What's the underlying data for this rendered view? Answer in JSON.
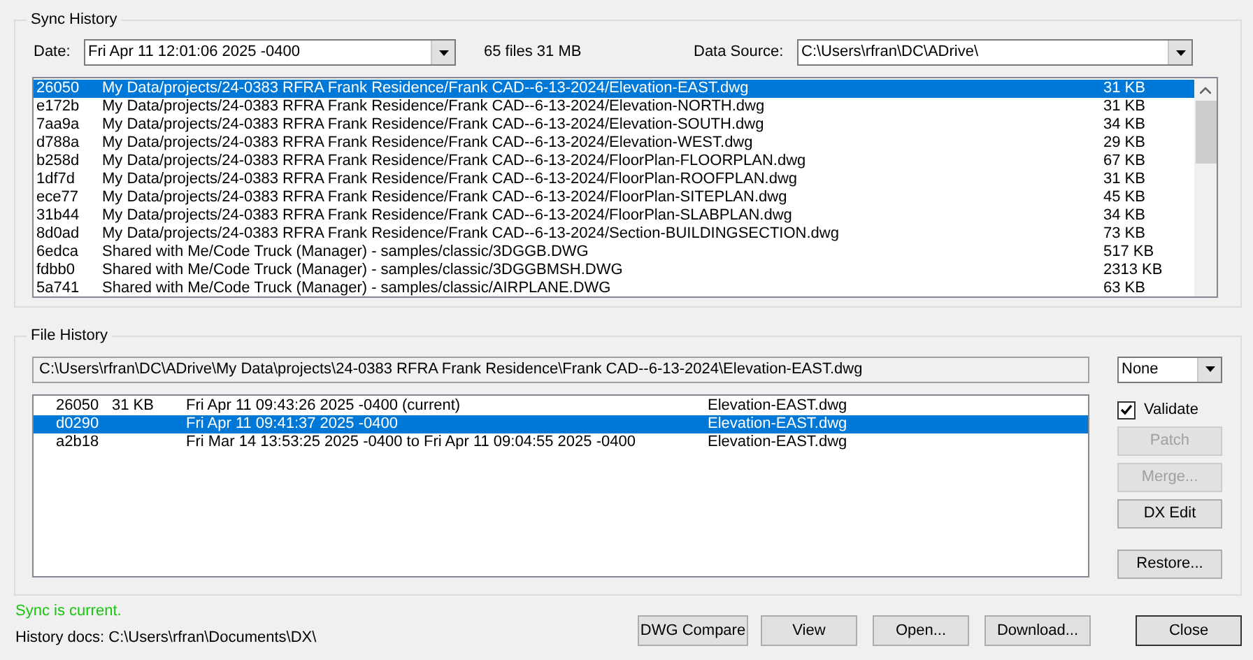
{
  "sync_history": {
    "title": "Sync History",
    "date_label": "Date:",
    "date_value": "Fri Apr 11 12:01:06 2025 -0400",
    "summary": "65 files 31 MB",
    "source_label": "Data Source:",
    "source_value": "C:\\Users\\rfran\\DC\\ADrive\\",
    "files": [
      {
        "id": "26050",
        "path": "My Data/projects/24-0383 RFRA Frank Residence/Frank CAD--6-13-2024/Elevation-EAST.dwg",
        "size": "31 KB",
        "selected": true
      },
      {
        "id": "e172b",
        "path": "My Data/projects/24-0383 RFRA Frank Residence/Frank CAD--6-13-2024/Elevation-NORTH.dwg",
        "size": "31 KB",
        "selected": false
      },
      {
        "id": "7aa9a",
        "path": "My Data/projects/24-0383 RFRA Frank Residence/Frank CAD--6-13-2024/Elevation-SOUTH.dwg",
        "size": "34 KB",
        "selected": false
      },
      {
        "id": "d788a",
        "path": "My Data/projects/24-0383 RFRA Frank Residence/Frank CAD--6-13-2024/Elevation-WEST.dwg",
        "size": "29 KB",
        "selected": false
      },
      {
        "id": "b258d",
        "path": "My Data/projects/24-0383 RFRA Frank Residence/Frank CAD--6-13-2024/FloorPlan-FLOORPLAN.dwg",
        "size": "67 KB",
        "selected": false
      },
      {
        "id": "1df7d",
        "path": "My Data/projects/24-0383 RFRA Frank Residence/Frank CAD--6-13-2024/FloorPlan-ROOFPLAN.dwg",
        "size": "31 KB",
        "selected": false
      },
      {
        "id": "ece77",
        "path": "My Data/projects/24-0383 RFRA Frank Residence/Frank CAD--6-13-2024/FloorPlan-SITEPLAN.dwg",
        "size": "45 KB",
        "selected": false
      },
      {
        "id": "31b44",
        "path": "My Data/projects/24-0383 RFRA Frank Residence/Frank CAD--6-13-2024/FloorPlan-SLABPLAN.dwg",
        "size": "34 KB",
        "selected": false
      },
      {
        "id": "8d0ad",
        "path": "My Data/projects/24-0383 RFRA Frank Residence/Frank CAD--6-13-2024/Section-BUILDINGSECTION.dwg",
        "size": "73 KB",
        "selected": false
      },
      {
        "id": "6edca",
        "path": "Shared with Me/Code Truck (Manager) - samples/classic/3DGGB.DWG",
        "size": "517 KB",
        "selected": false
      },
      {
        "id": "fdbb0",
        "path": "Shared with Me/Code Truck (Manager) - samples/classic/3DGGBMSH.DWG",
        "size": "2313 KB",
        "selected": false
      },
      {
        "id": "5a741",
        "path": "Shared with Me/Code Truck (Manager) - samples/classic/AIRPLANE.DWG",
        "size": "63 KB",
        "selected": false
      }
    ]
  },
  "file_history": {
    "title": "File History",
    "path": "C:\\Users\\rfran\\DC\\ADrive\\My Data\\projects\\24-0383 RFRA Frank Residence\\Frank CAD--6-13-2024\\Elevation-EAST.dwg",
    "mode": "None",
    "versions": [
      {
        "id": "26050",
        "size": "31 KB",
        "date": "Fri Apr 11 09:43:26 2025 -0400 (current)",
        "file": "Elevation-EAST.dwg",
        "selected": false
      },
      {
        "id": "d0290",
        "date": "Fri Apr 11 09:41:37 2025 -0400",
        "file": "Elevation-EAST.dwg",
        "selected": true
      },
      {
        "id": "a2b18",
        "date": "Fri Mar 14 13:53:25 2025 -0400 to Fri Apr 11 09:04:55 2025 -0400",
        "file": "Elevation-EAST.dwg",
        "selected": false
      }
    ],
    "validate": {
      "label": "Validate",
      "checked": true
    },
    "actions": [
      {
        "label": "Patch",
        "disabled": true
      },
      {
        "label": "Merge...",
        "disabled": true
      },
      {
        "label": "DX Edit",
        "disabled": false
      },
      {
        "label": "Restore...",
        "disabled": false
      }
    ]
  },
  "status": "Sync is current.",
  "history_docs": "History docs: C:\\Users\\rfran\\Documents\\DX\\",
  "buttons": [
    {
      "label": "DWG Compare",
      "default": false
    },
    {
      "label": "View",
      "default": false
    },
    {
      "label": "Open...",
      "default": false
    },
    {
      "label": "Download...",
      "default": false
    },
    {
      "label": "Close",
      "default": true
    }
  ]
}
